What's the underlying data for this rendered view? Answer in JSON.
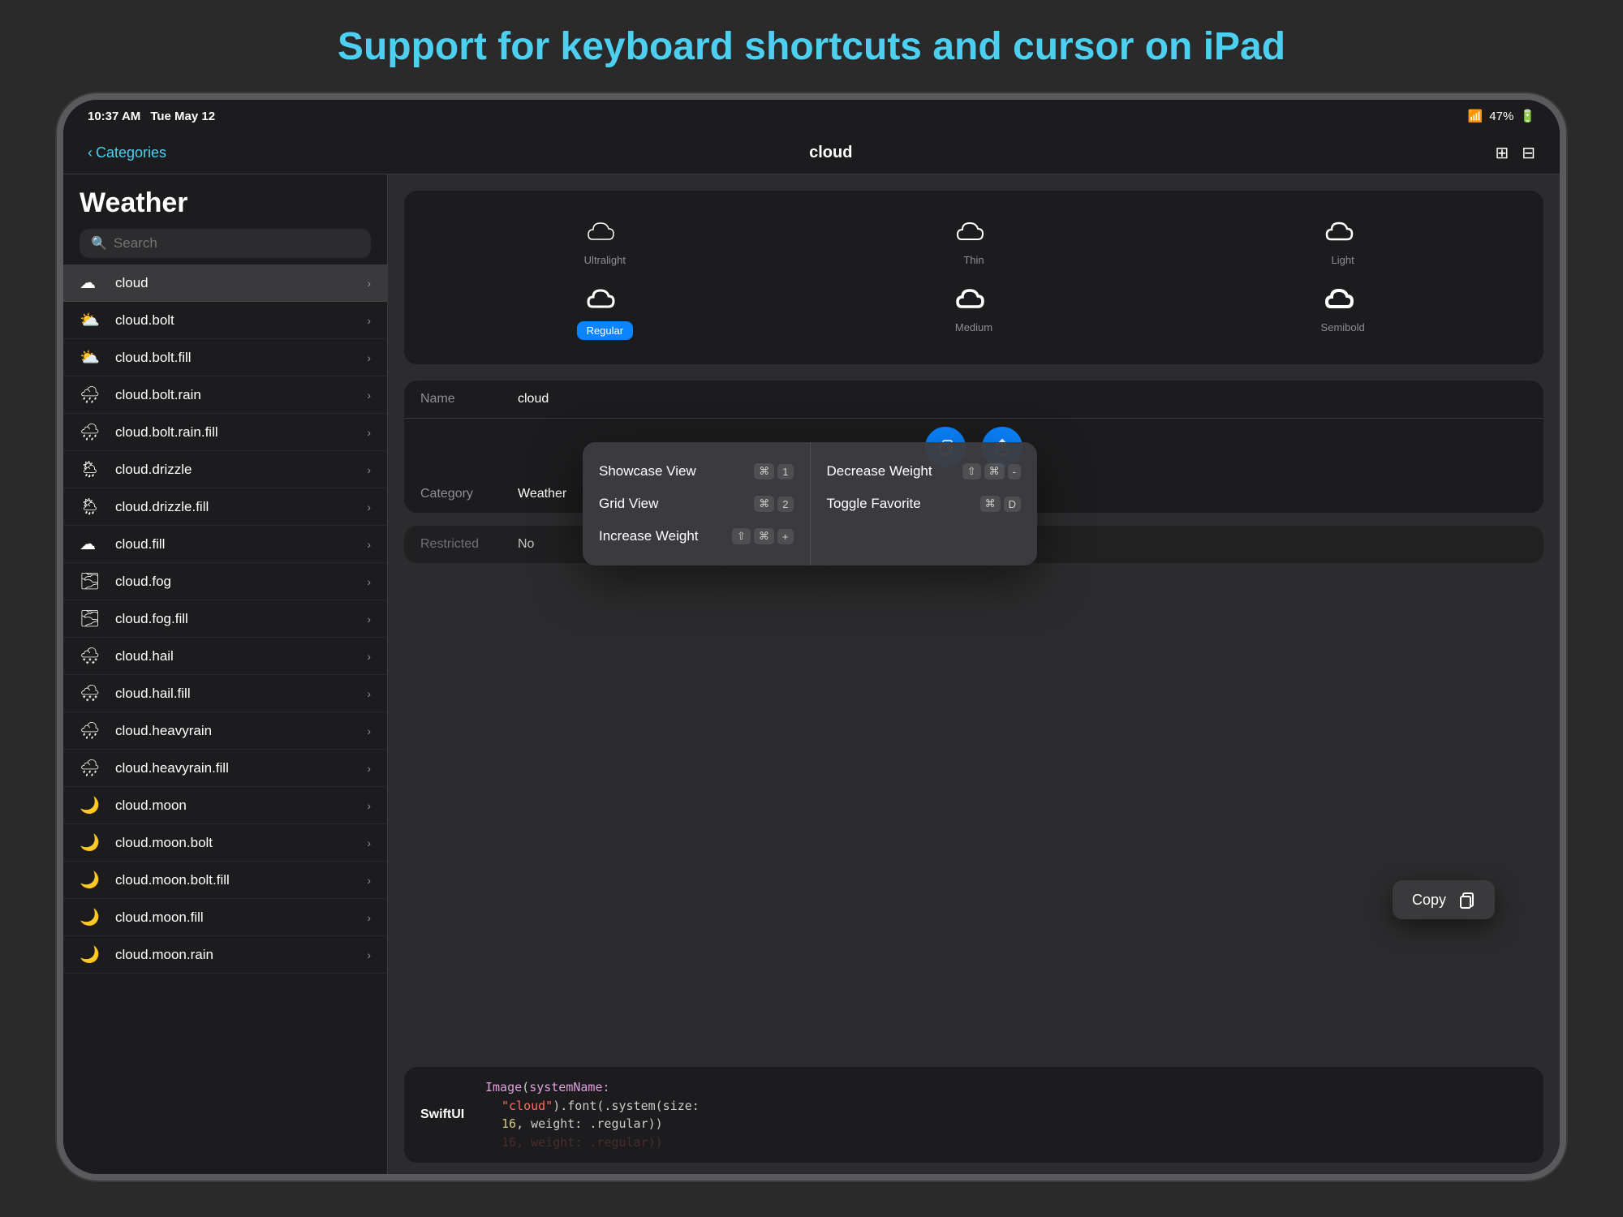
{
  "page": {
    "title": "Support for keyboard shortcuts and cursor on iPad"
  },
  "statusBar": {
    "time": "10:37 AM",
    "date": "Tue May 12",
    "battery": "47%",
    "wifi": "WiFi"
  },
  "navBar": {
    "back_label": "Categories",
    "title": "cloud",
    "icon_list": "list",
    "icon_grid": "grid"
  },
  "sidebar": {
    "title": "Weather",
    "search_placeholder": "Search",
    "items": [
      {
        "label": "cloud",
        "active": true
      },
      {
        "label": "cloud.bolt",
        "active": false
      },
      {
        "label": "cloud.bolt.fill",
        "active": false
      },
      {
        "label": "cloud.bolt.rain",
        "active": false
      },
      {
        "label": "cloud.bolt.rain.fill",
        "active": false
      },
      {
        "label": "cloud.drizzle",
        "active": false
      },
      {
        "label": "cloud.drizzle.fill",
        "active": false
      },
      {
        "label": "cloud.fill",
        "active": false
      },
      {
        "label": "cloud.fog",
        "active": false
      },
      {
        "label": "cloud.fog.fill",
        "active": false
      },
      {
        "label": "cloud.hail",
        "active": false
      },
      {
        "label": "cloud.hail.fill",
        "active": false
      },
      {
        "label": "cloud.heavyrain",
        "active": false
      },
      {
        "label": "cloud.heavyrain.fill",
        "active": false
      },
      {
        "label": "cloud.moon",
        "active": false
      },
      {
        "label": "cloud.moon.bolt",
        "active": false
      },
      {
        "label": "cloud.moon.bolt.fill",
        "active": false
      },
      {
        "label": "cloud.moon.fill",
        "active": false
      },
      {
        "label": "cloud.moon.rain",
        "active": false
      }
    ]
  },
  "iconGrid": {
    "row1": [
      {
        "label": "Ultralight",
        "selected": false
      },
      {
        "label": "Thin",
        "selected": false
      },
      {
        "label": "Light",
        "selected": false
      }
    ],
    "row2": [
      {
        "label": "Regular",
        "selected": true
      },
      {
        "label": "Medium",
        "selected": false
      },
      {
        "label": "Semibold",
        "selected": false
      }
    ]
  },
  "infoPanel": {
    "name_key": "Name",
    "name_val": "cloud",
    "category_key": "Category",
    "category_val": "Weather",
    "restricted_key": "Restricted",
    "restricted_val": "No"
  },
  "copyOverlay": {
    "label": "Copy"
  },
  "shortcuts": {
    "items_left": [
      {
        "name": "Showcase View",
        "keys": [
          "⌘",
          "1"
        ]
      },
      {
        "name": "Grid View",
        "keys": [
          "⌘",
          "2"
        ]
      },
      {
        "name": "Increase Weight",
        "keys": [
          "⇧",
          "⌘",
          "+"
        ]
      }
    ],
    "items_right": [
      {
        "name": "Decrease Weight",
        "keys": [
          "⇧",
          "⌘",
          "-"
        ]
      },
      {
        "name": "Toggle Favorite",
        "keys": [
          "⌘",
          "D"
        ]
      }
    ]
  },
  "swiftUI": {
    "label": "SwiftUI",
    "code_line1": "Image(systemName:",
    "code_str": "\"cloud\"",
    "code_line2": ").font(.system(size:",
    "code_num": "16",
    "code_line3": ", weight: .regular))",
    "code_dim": "16, weight: .regular))"
  }
}
